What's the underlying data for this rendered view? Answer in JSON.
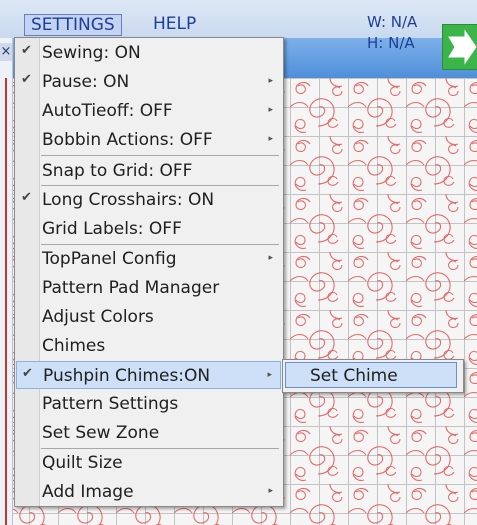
{
  "menubar": {
    "settings_label": "SETTINGS",
    "help_label": "HELP"
  },
  "info": {
    "width": "W: N/A",
    "height": "H: N/A"
  },
  "close_glyph": "×",
  "settings_menu": {
    "items": [
      {
        "label": "Sewing: ON",
        "checked": true,
        "submenu": false
      },
      {
        "label": "Pause: ON",
        "checked": true,
        "submenu": true
      },
      {
        "label": "AutoTieoff: OFF",
        "checked": false,
        "submenu": true
      },
      {
        "label": "Bobbin Actions: OFF",
        "checked": false,
        "submenu": true
      },
      {
        "label": "Snap to Grid: OFF",
        "checked": false,
        "submenu": false
      },
      {
        "label": "Long Crosshairs: ON",
        "checked": true,
        "submenu": false
      },
      {
        "label": "Grid Labels: OFF",
        "checked": false,
        "submenu": false
      },
      {
        "label": "TopPanel Config",
        "checked": false,
        "submenu": true
      },
      {
        "label": "Pattern Pad Manager",
        "checked": false,
        "submenu": false
      },
      {
        "label": "Adjust Colors",
        "checked": false,
        "submenu": false
      },
      {
        "label": "Chimes",
        "checked": false,
        "submenu": false
      },
      {
        "label": "Pushpin Chimes:ON",
        "checked": true,
        "submenu": true
      },
      {
        "label": "Pattern Settings",
        "checked": false,
        "submenu": false
      },
      {
        "label": "Set Sew Zone",
        "checked": false,
        "submenu": false
      },
      {
        "label": "Quilt Size",
        "checked": false,
        "submenu": false
      },
      {
        "label": "Add Image",
        "checked": false,
        "submenu": true
      }
    ],
    "check_glyph": "✔",
    "arrow_glyph": "▸"
  },
  "submenu": {
    "label": "Set Chime"
  },
  "icons": {
    "go_button": "green-arrow-icon",
    "checkmark": "check-icon",
    "submenu_arrow": "chevron-right-icon"
  },
  "colors": {
    "menu_text_blue": "#1f3f96",
    "highlight": "#cde0f7",
    "pattern_red": "#e05a5a"
  }
}
